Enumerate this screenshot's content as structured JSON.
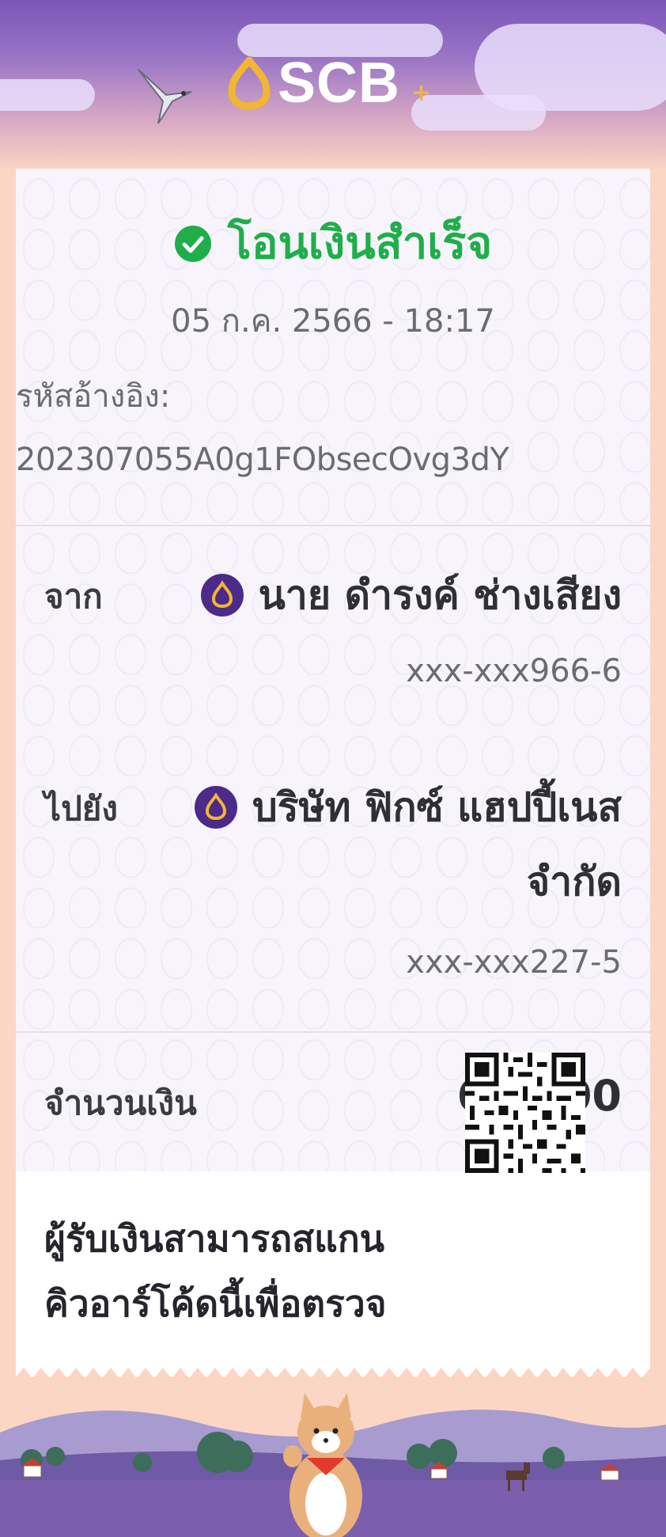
{
  "brand": {
    "name": "SCB",
    "plus": "+"
  },
  "transfer": {
    "status": "โอนเงินสำเร็จ",
    "datetime": "05 ก.ค. 2566 - 18:17",
    "reference_label": "รหัสอ้างอิง:",
    "reference_value": "202307055A0g1FObsecOvg3dY"
  },
  "from": {
    "label": "จาก",
    "name": "นาย ดำรงค์ ช่างเสียง",
    "account": "xxx-xxx966-6"
  },
  "to": {
    "label": "ไปยัง",
    "name_line1": "บริษัท ฟิกซ์ แฮปปี้เนส",
    "name_line2": "จำกัด",
    "account": "xxx-xxx227-5"
  },
  "amount": {
    "label": "จำนวนเงิน",
    "value": "690.00"
  },
  "qr_note": {
    "line1": "ผู้รับเงินสามารถสแกน",
    "line2": "คิวอาร์โค้ดนี้เพื่อตรวจ"
  },
  "colors": {
    "brand_purple": "#4b2a8a",
    "success_green": "#1fae4a",
    "logo_gold": "#f2b632",
    "page_peach": "#fbd6c4"
  },
  "icons": [
    "scb-logo-icon",
    "bird-icon",
    "check-circle-icon",
    "bank-icon",
    "qr-code"
  ]
}
